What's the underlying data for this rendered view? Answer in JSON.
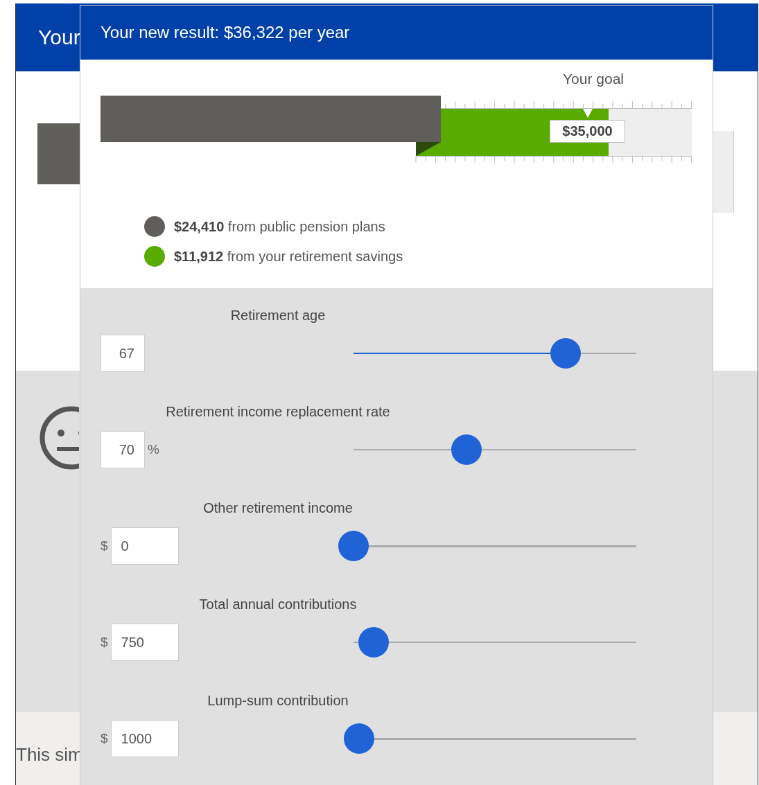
{
  "background_page": {
    "header_title": "Your",
    "footer_text": "This sim"
  },
  "dialog": {
    "title": "Your new result: $36,322 per year",
    "goal": {
      "label": "Your goal",
      "value": "$35,000"
    },
    "legend": [
      {
        "amount": "$24,410",
        "text": "from public pension plans",
        "color": "#5f5e5a"
      },
      {
        "amount": "$11,912",
        "text": "from your retirement savings",
        "color": "#5aab00"
      }
    ],
    "controls": [
      {
        "label": "Retirement age",
        "value": "67",
        "level": 0.75,
        "filled": true
      },
      {
        "label": "Retirement income replacement rate",
        "value": "70",
        "suffix": "%",
        "level": 0.4
      },
      {
        "label": "Other retirement income",
        "prefix": "$",
        "value": "0",
        "level": 0.0
      },
      {
        "label": "Total annual contributions",
        "prefix": "$",
        "value": "750",
        "level": 0.07
      },
      {
        "label": "Lump-sum contribution",
        "prefix": "$",
        "value": "1000",
        "level": 0.02
      }
    ]
  }
}
